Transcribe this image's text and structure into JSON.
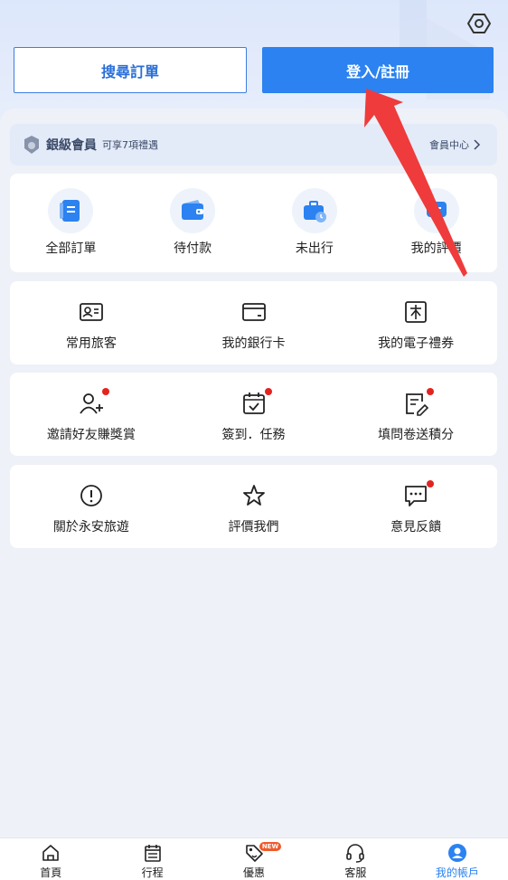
{
  "header": {
    "search_order_label": "搜尋訂單",
    "login_label": "登入/註冊"
  },
  "member": {
    "level": "銀級會員",
    "benefits": "可享7項禮遇",
    "center_link": "會員中心"
  },
  "orders": [
    {
      "label": "全部訂單",
      "icon": "document-icon"
    },
    {
      "label": "待付款",
      "icon": "wallet-icon"
    },
    {
      "label": "未出行",
      "icon": "briefcase-clock-icon"
    },
    {
      "label": "我的評價",
      "icon": "chat-icon"
    }
  ],
  "row1": [
    {
      "label": "常用旅客",
      "icon": "id-card-icon"
    },
    {
      "label": "我的銀行卡",
      "icon": "bank-card-icon"
    },
    {
      "label": "我的電子禮券",
      "icon": "voucher-icon"
    }
  ],
  "row2": [
    {
      "label": "邀請好友賺獎賞",
      "icon": "add-user-icon"
    },
    {
      "label": "簽到．任務",
      "icon": "calendar-check-icon"
    },
    {
      "label": "填問卷送積分",
      "icon": "survey-edit-icon"
    }
  ],
  "row3": [
    {
      "label": "關於永安旅遊",
      "icon": "info-icon"
    },
    {
      "label": "評價我們",
      "icon": "star-icon"
    },
    {
      "label": "意見反饋",
      "icon": "feedback-icon"
    }
  ],
  "tabs": [
    {
      "label": "首頁",
      "icon": "home-icon"
    },
    {
      "label": "行程",
      "icon": "itinerary-icon"
    },
    {
      "label": "優惠",
      "icon": "coupon-icon",
      "badge": "NEW"
    },
    {
      "label": "客服",
      "icon": "headset-icon"
    },
    {
      "label": "我的帳戶",
      "icon": "account-icon"
    }
  ],
  "colors": {
    "accent": "#2b82f0",
    "annotation_arrow": "#ef3b3b",
    "dot": "#e4231f"
  }
}
